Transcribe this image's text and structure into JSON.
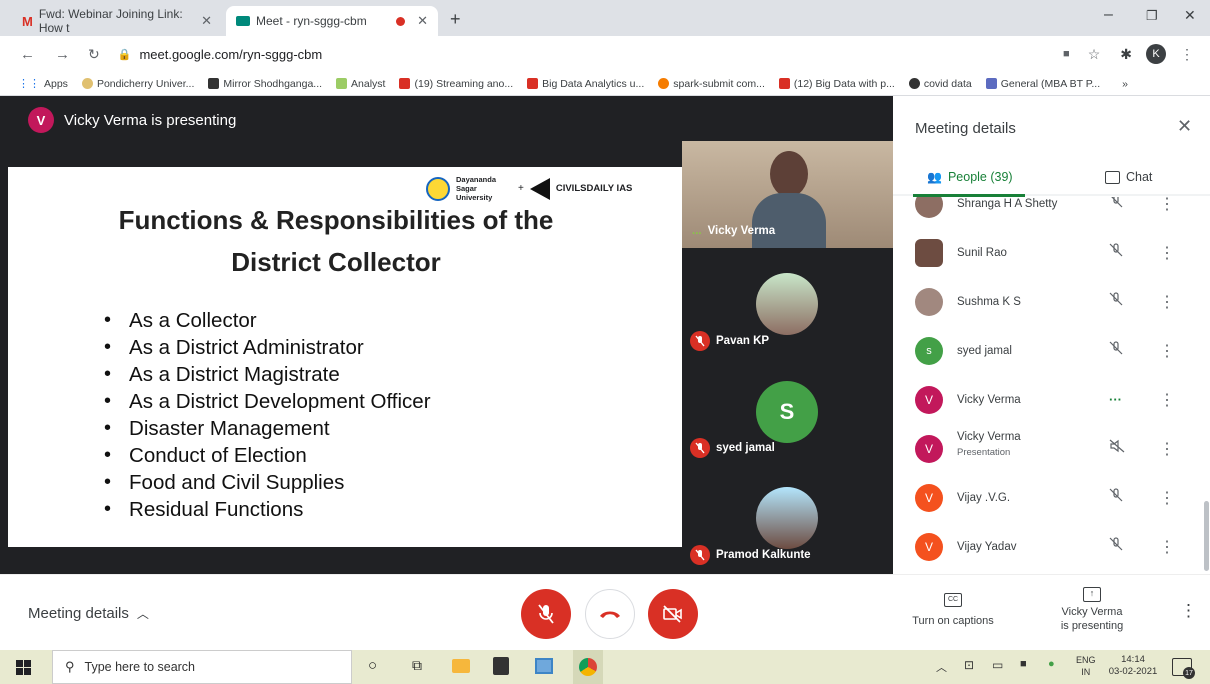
{
  "browser": {
    "tabs": [
      {
        "title": "Fwd: Webinar Joining Link: How t",
        "icon": "gmail-icon"
      },
      {
        "title": "Meet - ryn-sggg-cbm",
        "icon": "meet-icon"
      }
    ],
    "url": "meet.google.com/ryn-sggg-cbm",
    "profile_initial": "K",
    "bookmarks": [
      "Apps",
      "Pondicherry Univer...",
      "Mirror Shodhganga...",
      "Analyst",
      "(19) Streaming ano...",
      "Big Data Analytics u...",
      "spark-submit com...",
      "(12) Big Data with p...",
      "covid data",
      "General (MBA BT P..."
    ],
    "more_bookmarks": "»"
  },
  "presenter_banner": {
    "initial": "V",
    "text": "Vicky Verma is presenting"
  },
  "slide": {
    "logo_text_1": "Dayananda Sagar University",
    "logo_plus": "+",
    "logo_text_2": "CIVILSDAILY IAS",
    "title_line1": "Functions & Responsibilities of the",
    "title_line2": "District Collector",
    "bullets": [
      "As a Collector",
      "As a District Administrator",
      "As a District Magistrate",
      "As a District Development Officer",
      "Disaster Management",
      "Conduct of Election",
      "Food and Civil Supplies",
      "Residual Functions"
    ]
  },
  "tiles": [
    {
      "name": "Vicky Verma",
      "indicator": "..."
    },
    {
      "name": "Pavan KP"
    },
    {
      "name": "syed jamal",
      "initial": "S"
    },
    {
      "name": "Pramod Kalkunte"
    }
  ],
  "panel": {
    "title": "Meeting details",
    "tab_people": "People (39)",
    "tab_chat": "Chat",
    "participants": [
      {
        "name": "Shranga H A Shetty",
        "sub": "",
        "initial": "",
        "color": "#8d6e63",
        "status": "muted"
      },
      {
        "name": "Sunil Rao",
        "sub": "",
        "initial": "",
        "color": "#6d4c41",
        "status": "muted"
      },
      {
        "name": "Sushma K S",
        "sub": "",
        "initial": "",
        "color": "#a1887f",
        "status": "muted"
      },
      {
        "name": "syed jamal",
        "sub": "",
        "initial": "s",
        "color": "#43a047",
        "status": "muted"
      },
      {
        "name": "Vicky Verma",
        "sub": "",
        "initial": "V",
        "color": "#c2185b",
        "status": "speaking"
      },
      {
        "name": "Vicky Verma",
        "sub": "Presentation",
        "initial": "V",
        "color": "#c2185b",
        "status": "audio-off"
      },
      {
        "name": "Vijay .V.G.",
        "sub": "",
        "initial": "V",
        "color": "#f4511e",
        "status": "muted"
      },
      {
        "name": "Vijay Yadav",
        "sub": "",
        "initial": "V",
        "color": "#f4511e",
        "status": "muted"
      }
    ]
  },
  "bottom": {
    "meeting_details": "Meeting details",
    "captions_label": "Turn on captions",
    "presenting_line1": "Vicky Verma",
    "presenting_line2": "is presenting"
  },
  "taskbar": {
    "search_placeholder": "Type here to search",
    "lang_line1": "ENG",
    "lang_line2": "IN",
    "time": "14:14",
    "date": "03-02-2021",
    "notification_count": "17"
  },
  "colors": {
    "accent": "#1a73e8",
    "danger": "#d93025",
    "meet_bg": "#202124",
    "people_green": "#188038"
  }
}
